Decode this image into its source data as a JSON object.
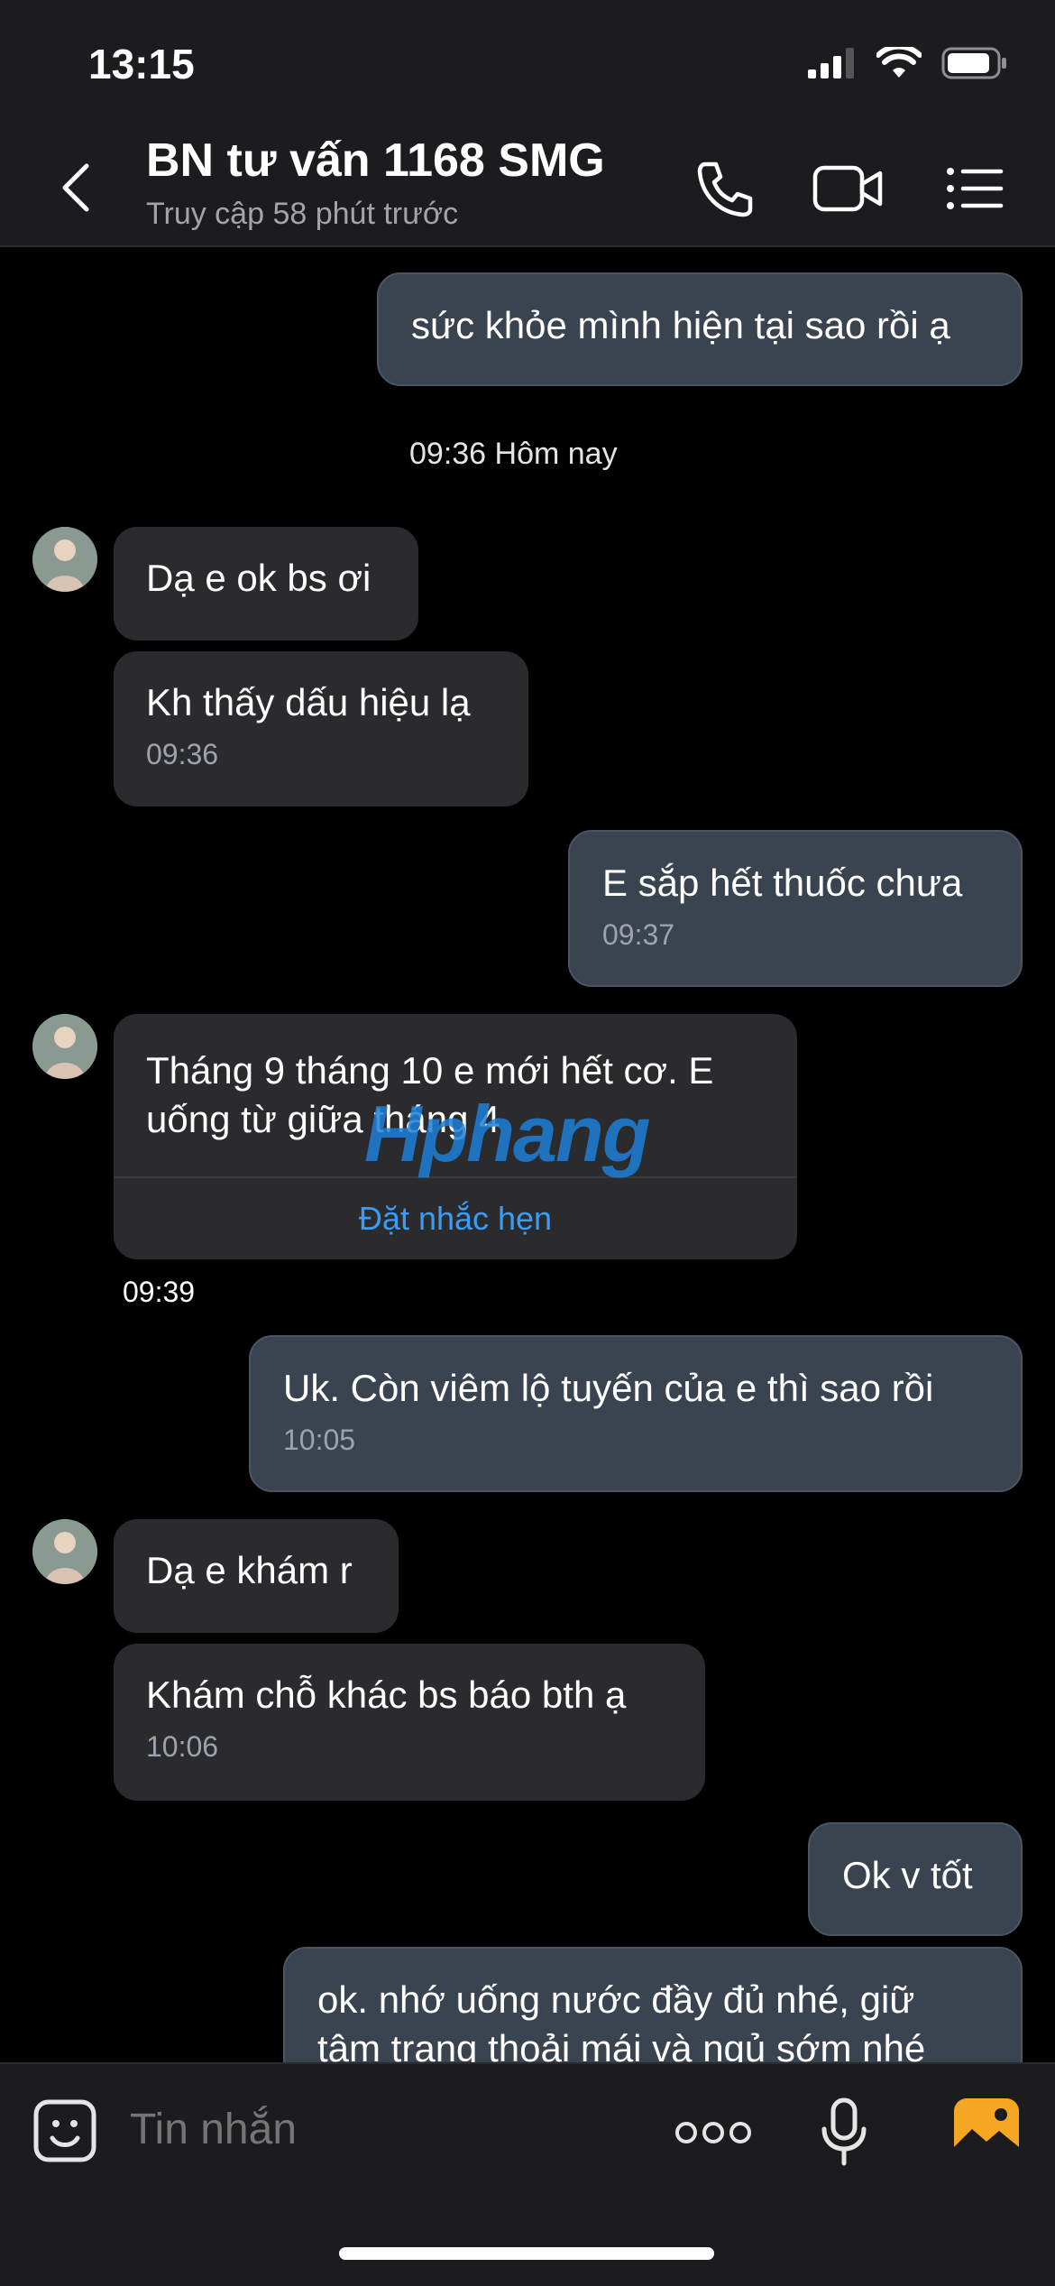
{
  "status_bar": {
    "time": "13:15"
  },
  "header": {
    "title": "BN tư vấn 1168 SMG",
    "subtitle": "Truy cập 58 phút trước",
    "icons": [
      "back-icon",
      "phone-icon",
      "video-call-icon",
      "menu-list-icon"
    ]
  },
  "messages": {
    "m1": {
      "text": "sức khỏe mình hiện tại sao rồi ạ"
    },
    "sep1": "09:36 Hôm nay",
    "m2": {
      "text": "Dạ e ok bs ơi"
    },
    "m3": {
      "text": "Kh thấy dấu hiệu lạ",
      "time": "09:36"
    },
    "m4": {
      "text": "E sắp hết thuốc chưa",
      "time": "09:37"
    },
    "m5": {
      "text": "Tháng 9 tháng 10 e mới hết cơ. E uống từ giữa tháng 4",
      "action": "Đặt nhắc hẹn"
    },
    "m5_time": "09:39",
    "watermark": "Hphang",
    "m6": {
      "text": "Uk. Còn viêm lộ tuyến của e thì sao rồi",
      "time": "10:05"
    },
    "m7": {
      "text": "Dạ e khám r"
    },
    "m8": {
      "text": "Khám chỗ khác bs báo bth ạ",
      "time": "10:06"
    },
    "m9": {
      "text": "Ok v tốt"
    },
    "m10": {
      "text": "ok. nhớ uống nước đầy đủ nhé, giữ tâm trạng thoải mái và ngủ sớm nhé"
    }
  },
  "composer": {
    "placeholder": "Tin nhắn",
    "icons": [
      "sticker-icon",
      "more-icon",
      "microphone-icon",
      "gallery-icon"
    ]
  },
  "colors": {
    "outgoing_bubble": "#3a4350",
    "incoming_bubble": "#2b2b2e",
    "link_blue": "#3b9cf5",
    "gallery_orange": "#f5a623"
  }
}
